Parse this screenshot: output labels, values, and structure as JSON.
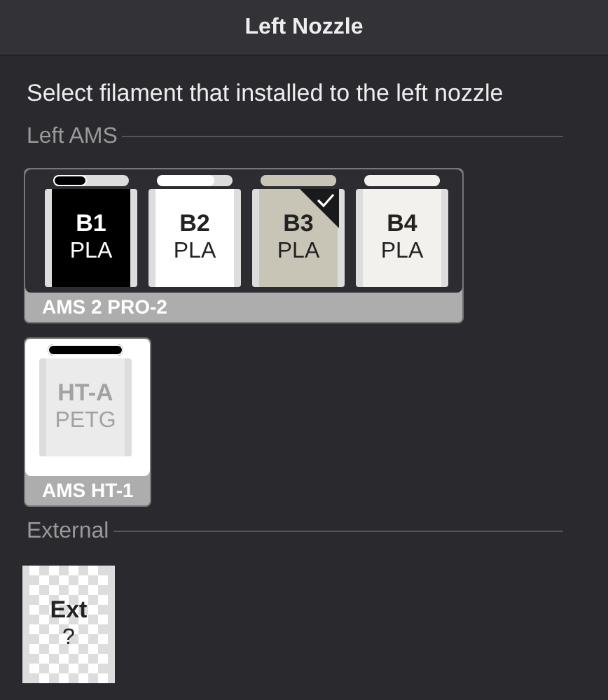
{
  "dialog": {
    "title": "Left Nozzle"
  },
  "instruction": "Select filament that installed to the left nozzle",
  "sections": [
    {
      "label": "Left AMS",
      "groups": [
        {
          "name": "AMS 2 PRO-2",
          "disabled": false,
          "slots": [
            {
              "kind": "filament",
              "id": "B1",
              "material": "PLA",
              "color": "#000000",
              "level": 0.45,
              "selected": false
            },
            {
              "kind": "filament",
              "id": "B2",
              "material": "PLA",
              "color": "#ffffff",
              "level": 0.75,
              "selected": false
            },
            {
              "kind": "filament",
              "id": "B3",
              "material": "PLA",
              "color": "#c9c5b6",
              "level": 1,
              "selected": true
            },
            {
              "kind": "filament",
              "id": "B4",
              "material": "PLA",
              "color": "#f3f1ed",
              "level": 1,
              "selected": false
            }
          ]
        },
        {
          "name": "AMS HT-1",
          "disabled": true,
          "slots": [
            {
              "kind": "filament",
              "id": "HT-A",
              "material": "PETG",
              "color": "#000000",
              "level": 1,
              "selected": false
            }
          ]
        }
      ]
    },
    {
      "label": "External",
      "groups": [
        {
          "slots": [
            {
              "kind": "external",
              "id": "Ext",
              "material": "?"
            }
          ]
        }
      ]
    }
  ]
}
